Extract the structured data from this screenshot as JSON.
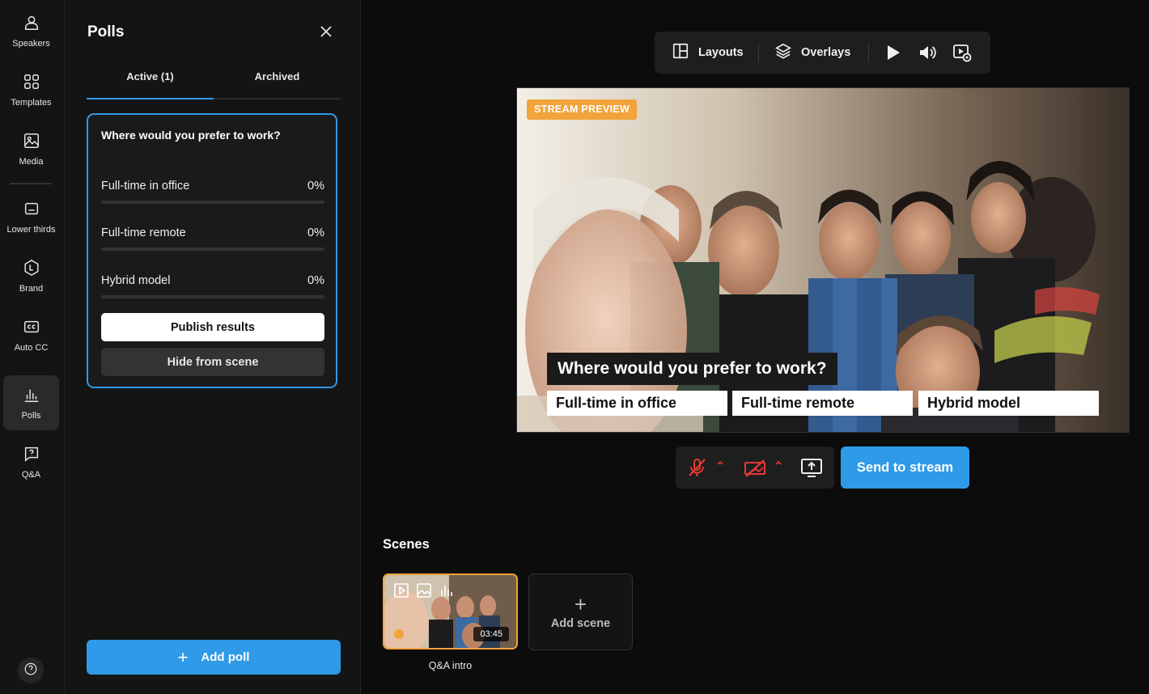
{
  "rail": {
    "items": [
      {
        "label": "Speakers",
        "icon": "person-icon"
      },
      {
        "label": "Templates",
        "icon": "grid-icon"
      },
      {
        "label": "Media",
        "icon": "image-icon"
      },
      {
        "label": "Lower thirds",
        "icon": "lower-third-icon"
      },
      {
        "label": "Brand",
        "icon": "brand-icon"
      },
      {
        "label": "Auto CC",
        "icon": "cc-icon"
      },
      {
        "label": "Polls",
        "icon": "bar-chart-icon",
        "active": true
      },
      {
        "label": "Q&A",
        "icon": "question-bubble-icon"
      }
    ],
    "help_icon": "help-icon"
  },
  "panel": {
    "title": "Polls",
    "tabs": [
      {
        "label": "Active (1)",
        "active": true
      },
      {
        "label": "Archived",
        "active": false
      }
    ],
    "poll": {
      "question": "Where would you prefer to work?",
      "options": [
        {
          "label": "Full-time in office",
          "percent": "0%",
          "value": 0
        },
        {
          "label": "Full-time remote",
          "percent": "0%",
          "value": 0
        },
        {
          "label": "Hybrid model",
          "percent": "0%",
          "value": 0
        }
      ],
      "publish_label": "Publish results",
      "hide_label": "Hide from scene"
    },
    "add_poll_label": "Add poll"
  },
  "toolbar": {
    "layouts_label": "Layouts",
    "overlays_label": "Overlays"
  },
  "preview": {
    "badge": "STREAM PREVIEW",
    "overlay_question": "Where would you prefer to work?",
    "overlay_options": [
      "Full-time in office",
      "Full-time remote",
      "Hybrid model"
    ]
  },
  "controls": {
    "send_label": "Send to stream",
    "mic_muted": true,
    "camera_off": true
  },
  "scenes": {
    "title": "Scenes",
    "items": [
      {
        "label": "Q&A intro",
        "duration": "03:45",
        "selected": true
      }
    ],
    "add_label": "Add scene"
  },
  "colors": {
    "accent": "#2e9ae8",
    "badge": "#f2a33a",
    "muted": "#e53935"
  }
}
